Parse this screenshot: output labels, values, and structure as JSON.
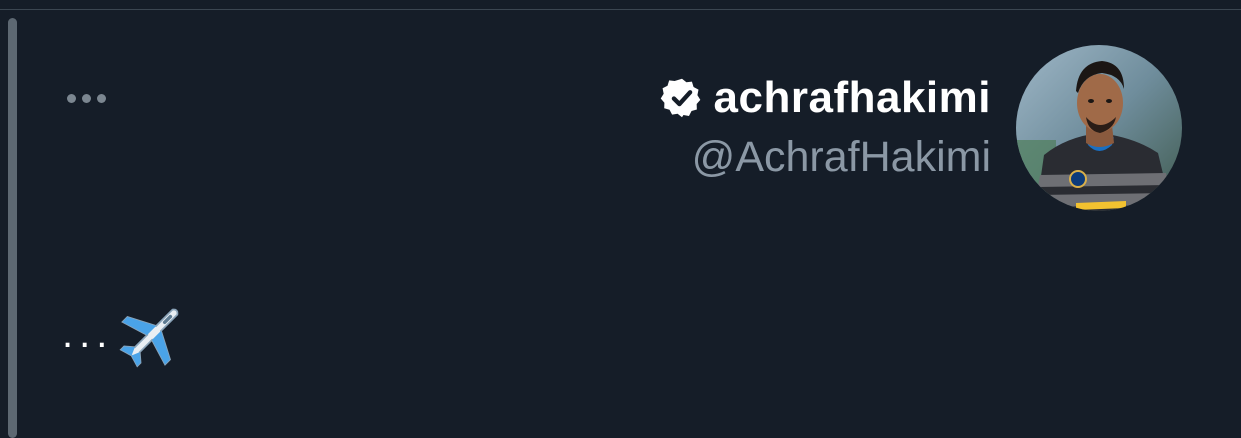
{
  "tweet": {
    "author": {
      "display_name": "achrafhakimi",
      "handle": "@AchrafHakimi",
      "verified": true,
      "avatar_icon": "profile-photo"
    },
    "more_icon": "more-horizontal-icon",
    "text": "...",
    "emoji_icon": "airplane-icon"
  },
  "colors": {
    "background": "#151d28",
    "name": "#ffffff",
    "handle": "#8b98a5",
    "thread_line": "#5d6872",
    "more_dots": "#7b8690"
  }
}
